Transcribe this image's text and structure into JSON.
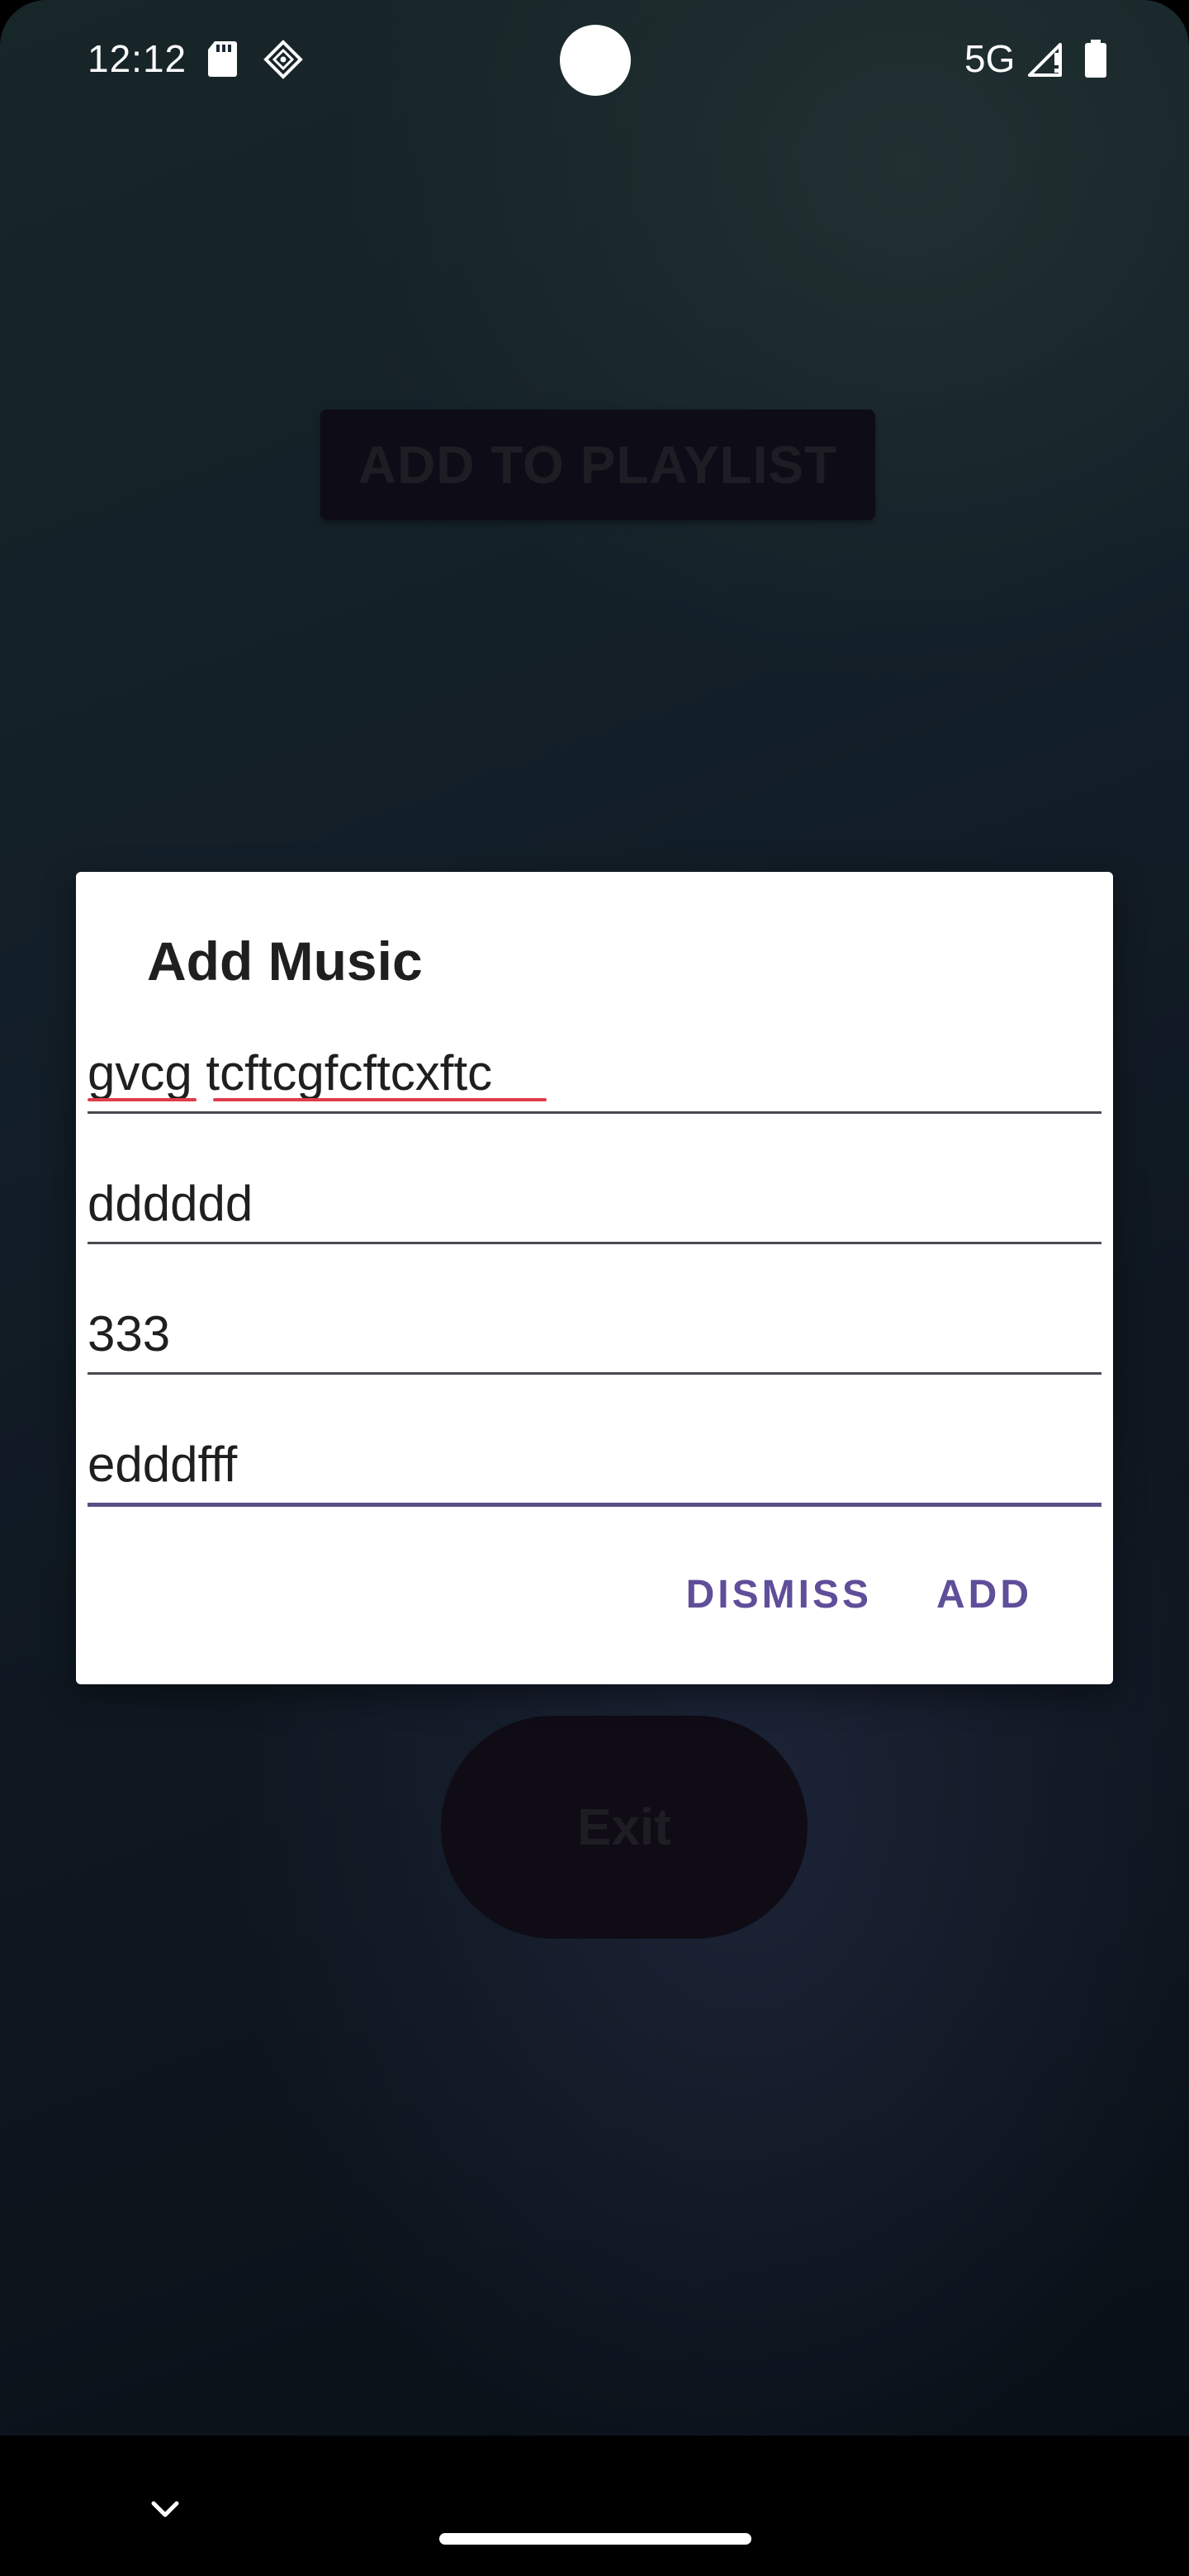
{
  "status_bar": {
    "time": "12:12",
    "network": "5G",
    "icons": [
      "sd-card-icon",
      "app-notification-icon",
      "signal-icon",
      "battery-icon"
    ]
  },
  "background": {
    "playlist_button_label": "ADD TO PLAYLIST",
    "exit_button_label": "Exit"
  },
  "dialog": {
    "title": "Add Music",
    "fields": [
      {
        "value": "gvcg tcftcgfcftcxftc"
      },
      {
        "value": "dddddd"
      },
      {
        "value": "333"
      },
      {
        "value": "edddfff",
        "focused": true
      }
    ],
    "dismiss_label": "DISMISS",
    "add_label": "ADD"
  },
  "nav_bar": {
    "icons": [
      "chevron-down-icon",
      "home-pill"
    ]
  },
  "colors": {
    "accent": "#5f4e99",
    "dialog_bg": "#ffffff",
    "spellcheck": "#e03c4c"
  }
}
